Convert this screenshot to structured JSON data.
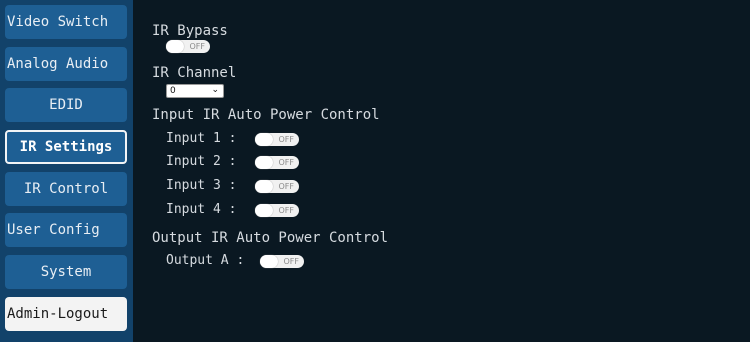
{
  "nav": {
    "video_switch": "Video Switch",
    "analog_audio": "Analog Audio",
    "edid": "EDID",
    "ir_settings": "IR Settings",
    "ir_control": "IR Control",
    "user_config": "User Config",
    "system": "System",
    "logout": "Admin-Logout"
  },
  "ir_bypass": {
    "label": "IR Bypass",
    "toggle_text": "OFF"
  },
  "ir_channel": {
    "label": "IR Channel",
    "selected": "0"
  },
  "input_power": {
    "label": "Input IR Auto Power Control",
    "rows": [
      {
        "label": "Input 1 :",
        "toggle_text": "OFF"
      },
      {
        "label": "Input 2 :",
        "toggle_text": "OFF"
      },
      {
        "label": "Input 3 :",
        "toggle_text": "OFF"
      },
      {
        "label": "Input 4 :",
        "toggle_text": "OFF"
      }
    ]
  },
  "output_power": {
    "label": "Output IR Auto Power Control",
    "rows": [
      {
        "label": "Output A :",
        "toggle_text": "OFF"
      }
    ]
  },
  "colors": {
    "sidebar": "#12426a",
    "nav_button": "#1e5f94",
    "content_bg": "#0a1822",
    "logout_bg": "#f3f3f3"
  }
}
